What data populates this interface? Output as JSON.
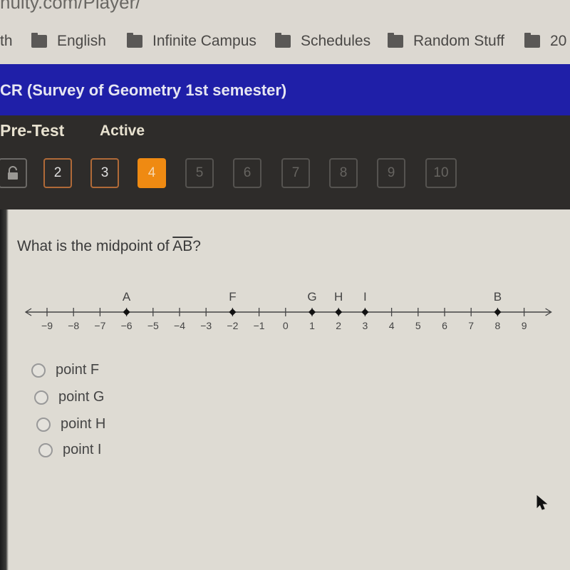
{
  "browser": {
    "url_fragment": "nuity.com/Player/",
    "bookmarks": [
      {
        "label": "th",
        "icon": "folder-icon",
        "has_icon": false
      },
      {
        "label": "English",
        "icon": "folder-icon"
      },
      {
        "label": "Infinite Campus",
        "icon": "folder-icon"
      },
      {
        "label": "Schedules",
        "icon": "folder-icon"
      },
      {
        "label": "Random Stuff",
        "icon": "folder-icon"
      },
      {
        "label": "20",
        "icon": "folder-icon"
      }
    ]
  },
  "course": {
    "title": "CR (Survey of Geometry 1st semester)"
  },
  "activity": {
    "label": "Pre-Test",
    "status": "Active"
  },
  "question_nav": {
    "items": [
      {
        "label": "",
        "state": "locked",
        "icon": "lock-icon"
      },
      {
        "label": "2",
        "state": "answered"
      },
      {
        "label": "3",
        "state": "answered"
      },
      {
        "label": "4",
        "state": "current"
      },
      {
        "label": "5",
        "state": "unvisited"
      },
      {
        "label": "6",
        "state": "unvisited"
      },
      {
        "label": "7",
        "state": "unvisited"
      },
      {
        "label": "8",
        "state": "unvisited"
      },
      {
        "label": "9",
        "state": "unvisited"
      },
      {
        "label": "10",
        "state": "unvisited"
      }
    ],
    "colors": {
      "current": "#ef8a12",
      "answered_border": "#b06a38"
    }
  },
  "question": {
    "prefix": "What is the midpoint of ",
    "segment": "AB",
    "suffix": "?"
  },
  "number_line": {
    "min": -9,
    "max": 9,
    "tick_labels": [
      "−9",
      "−8",
      "−7",
      "−6",
      "−5",
      "−4",
      "−3",
      "−2",
      "−1",
      "0",
      "1",
      "2",
      "3",
      "4",
      "5",
      "6",
      "7",
      "8",
      "9"
    ],
    "points": [
      {
        "label": "A",
        "value": -6
      },
      {
        "label": "F",
        "value": -2
      },
      {
        "label": "G",
        "value": 1
      },
      {
        "label": "H",
        "value": 2
      },
      {
        "label": "I",
        "value": 3
      },
      {
        "label": "B",
        "value": 8
      }
    ]
  },
  "answer_choices": [
    {
      "label": "point F",
      "selected": false
    },
    {
      "label": "point G",
      "selected": false
    },
    {
      "label": "point H",
      "selected": false
    },
    {
      "label": "point I",
      "selected": false
    }
  ]
}
